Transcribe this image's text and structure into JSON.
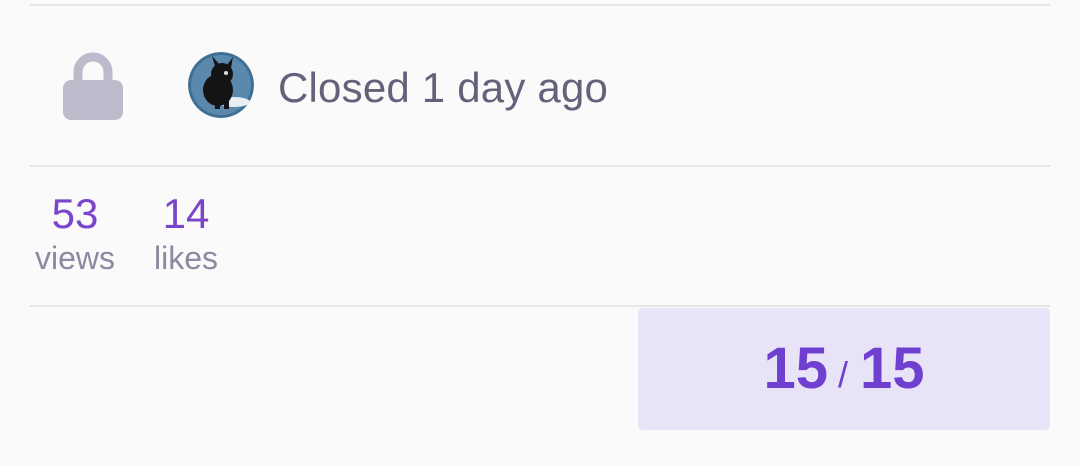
{
  "status": {
    "lock_icon": "lock-icon",
    "avatar_icon": "avatar-image",
    "text": "Closed 1 day ago"
  },
  "stats": {
    "views": {
      "value": "53",
      "label": "views"
    },
    "likes": {
      "value": "14",
      "label": "likes"
    }
  },
  "progress": {
    "current": "15",
    "separator": "/",
    "total": "15"
  },
  "colors": {
    "accent": "#7a44cc",
    "progress_bg": "#e9e3f8",
    "lock": "#bbbbcb",
    "muted_text": "#62627a"
  }
}
